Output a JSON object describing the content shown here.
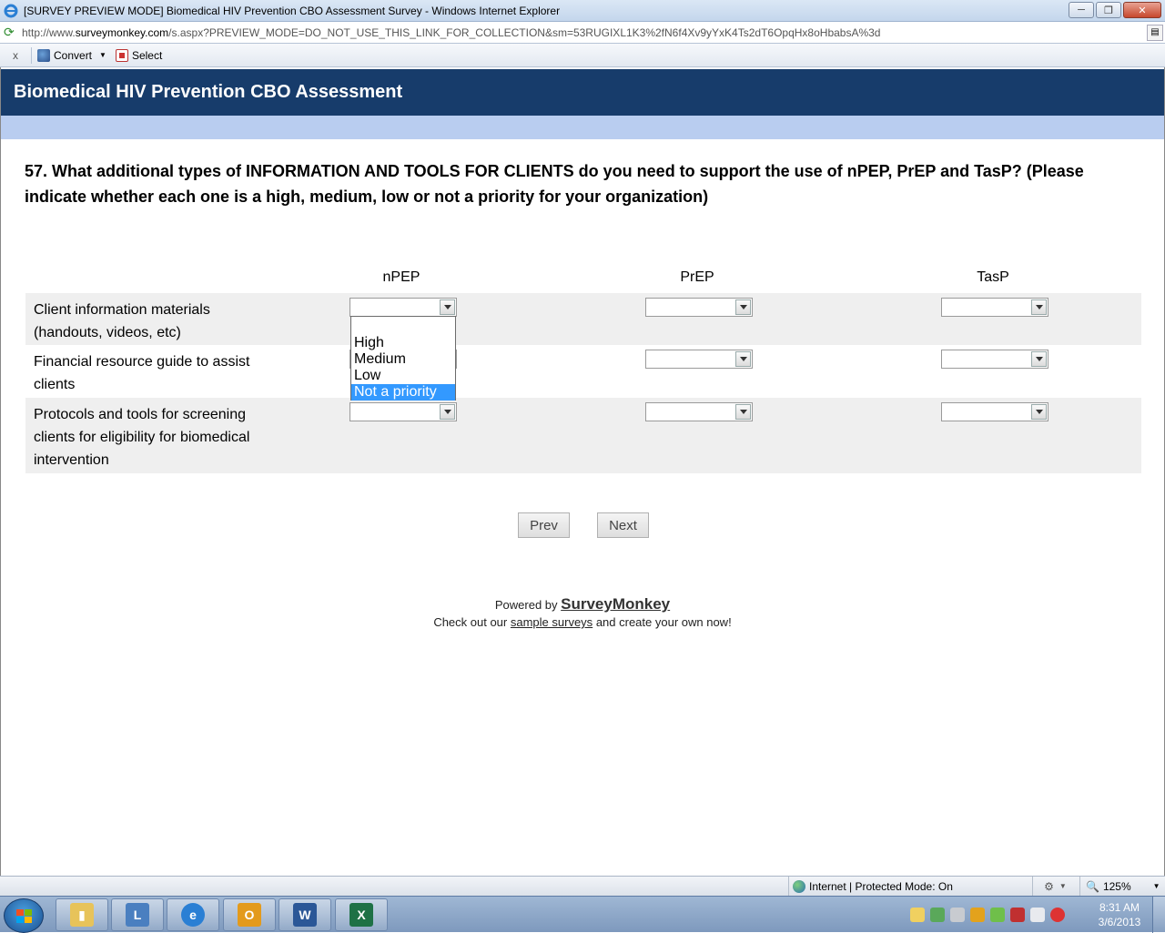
{
  "window": {
    "title": "[SURVEY PREVIEW MODE] Biomedical HIV Prevention CBO Assessment Survey - Windows Internet Explorer",
    "url_prefix": "http://www.",
    "url_domain": "surveymonkey.com",
    "url_rest": "/s.aspx?PREVIEW_MODE=DO_NOT_USE_THIS_LINK_FOR_COLLECTION&sm=53RUGIXL1K3%2fN6f4Xv9yYxK4Ts2dT6OpqHx8oHbabsA%3d"
  },
  "toolbar": {
    "close_label": "x",
    "convert_label": "Convert",
    "select_label": "Select"
  },
  "survey": {
    "header_title": "Biomedical HIV Prevention CBO Assessment",
    "question": "57. What additional types of INFORMATION AND TOOLS FOR CLIENTS do you need to support the use of nPEP, PrEP and TasP? (Please indicate whether each one is a high, medium, low or not a priority for your organization)",
    "columns": [
      "nPEP",
      "PrEP",
      "TasP"
    ],
    "rows": [
      {
        "label": "Client information materials (handouts, videos, etc)"
      },
      {
        "label": "Financial resource guide to assist clients"
      },
      {
        "label": "Protocols and tools for screening clients for eligibility for biomedical intervention"
      }
    ],
    "dropdown_options": [
      "",
      "High",
      "Medium",
      "Low",
      "Not a priority"
    ],
    "dropdown_highlighted": "Not a priority",
    "prev_label": "Prev",
    "next_label": "Next",
    "powered_by": "Powered by",
    "brand": "SurveyMonkey",
    "checkout_pre": "Check out our",
    "checkout_link": "sample surveys",
    "checkout_post": "and create your own now!"
  },
  "statusbar": {
    "zone": "Internet | Protected Mode: On",
    "zoom": "125%"
  },
  "taskbar": {
    "clock_time": "8:31 AM",
    "clock_date": "3/6/2013"
  },
  "colors": {
    "header_band": "#173c6b",
    "sub_band": "#b9cdf0",
    "highlight": "#3399ff"
  }
}
